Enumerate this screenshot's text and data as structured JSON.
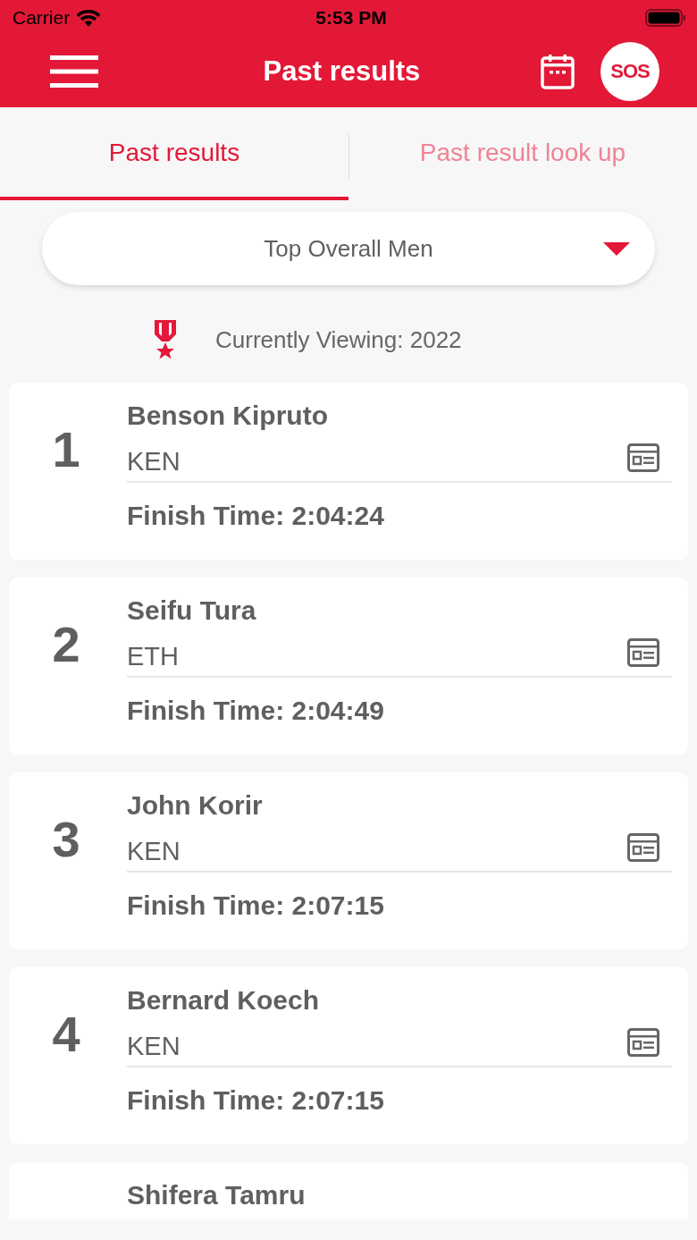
{
  "status_bar": {
    "carrier": "Carrier",
    "time": "5:53 PM"
  },
  "nav_bar": {
    "title": "Past results",
    "sos": "SOS"
  },
  "tabs": [
    {
      "label": "Past results",
      "selected": true
    },
    {
      "label": "Past result look up",
      "selected": false
    }
  ],
  "dropdown": {
    "value": "Top Overall Men"
  },
  "viewing": "Currently Viewing: 2022",
  "results": [
    {
      "rank": "1",
      "name": "Benson Kipruto",
      "country": "KEN",
      "finish": "Finish Time: 2:04:24"
    },
    {
      "rank": "2",
      "name": "Seifu Tura",
      "country": "ETH",
      "finish": "Finish Time: 2:04:49"
    },
    {
      "rank": "3",
      "name": "John Korir",
      "country": "KEN",
      "finish": "Finish Time: 2:07:15"
    },
    {
      "rank": "4",
      "name": "Bernard Koech",
      "country": "KEN",
      "finish": "Finish Time: 2:07:15"
    },
    {
      "name": "Shifera Tamru"
    }
  ]
}
